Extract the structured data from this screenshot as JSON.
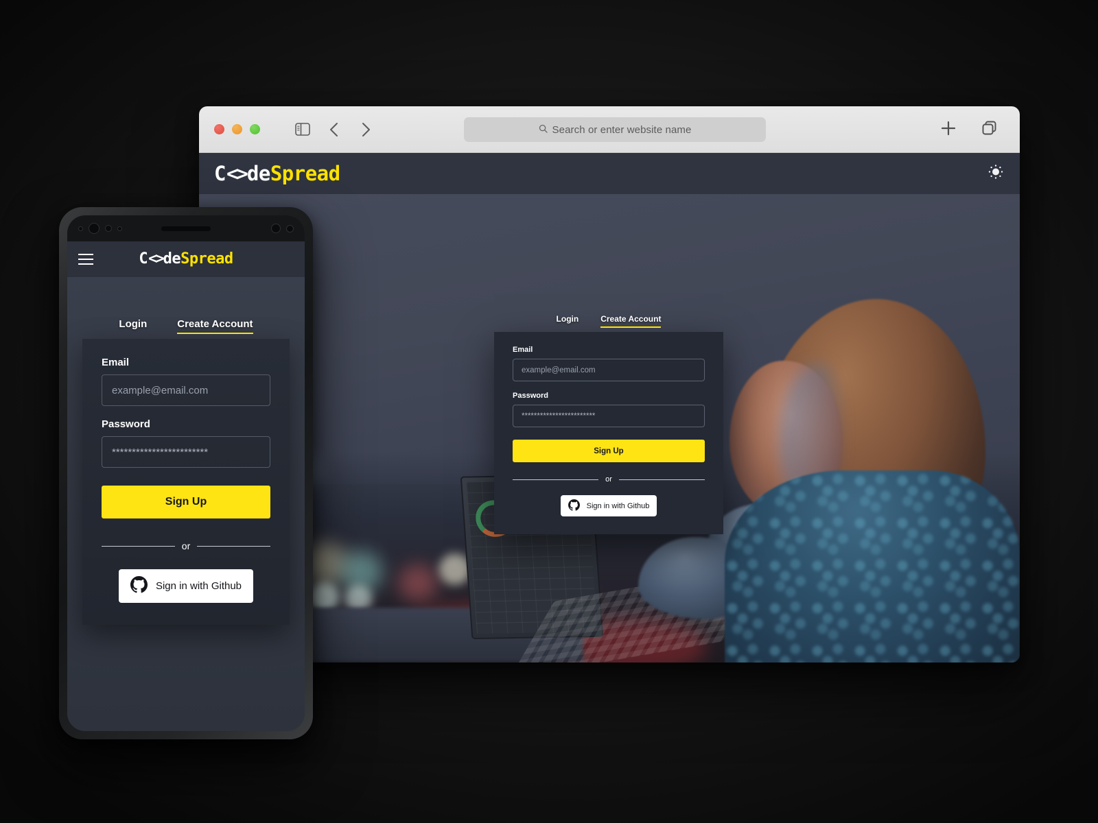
{
  "brand": {
    "name_prefix": "C",
    "name_brackets": "<>",
    "name_mid": "de",
    "name_suffix": "Spread",
    "accent_color": "#ffe200",
    "dark_color": "#2f3440"
  },
  "browser": {
    "traffic_lights": [
      "close-red",
      "minimize-yellow",
      "maximize-green"
    ],
    "sidebar_toggle_icon": "sidebar-icon",
    "back_icon": "chevron-left-icon",
    "forward_icon": "chevron-right-icon",
    "address_bar": {
      "placeholder": "Search or enter website name",
      "value": "",
      "search_icon": "search-icon"
    },
    "new_tab_icon": "plus-icon",
    "tab_overview_icon": "copy-tabs-icon"
  },
  "site_header": {
    "theme_toggle_icon": "sun-icon"
  },
  "desktop_auth": {
    "tabs": [
      {
        "label": "Login",
        "active": false
      },
      {
        "label": "Create Account",
        "active": true
      }
    ],
    "email": {
      "label": "Email",
      "placeholder": "example@email.com",
      "value": ""
    },
    "password": {
      "label": "Password",
      "placeholder": "",
      "value": "************************"
    },
    "submit_label": "Sign Up",
    "divider_label": "or",
    "github_label": "Sign in with Github",
    "github_icon": "github-icon"
  },
  "mobile": {
    "menu_icon": "hamburger-icon",
    "auth": {
      "tabs": [
        {
          "label": "Login",
          "active": false
        },
        {
          "label": "Create Account",
          "active": true
        }
      ],
      "email": {
        "label": "Email",
        "placeholder": "example@email.com",
        "value": ""
      },
      "password": {
        "label": "Password",
        "placeholder": "",
        "value": "************************"
      },
      "submit_label": "Sign Up",
      "divider_label": "or",
      "github_label": "Sign in with Github",
      "github_icon": "github-icon"
    }
  }
}
